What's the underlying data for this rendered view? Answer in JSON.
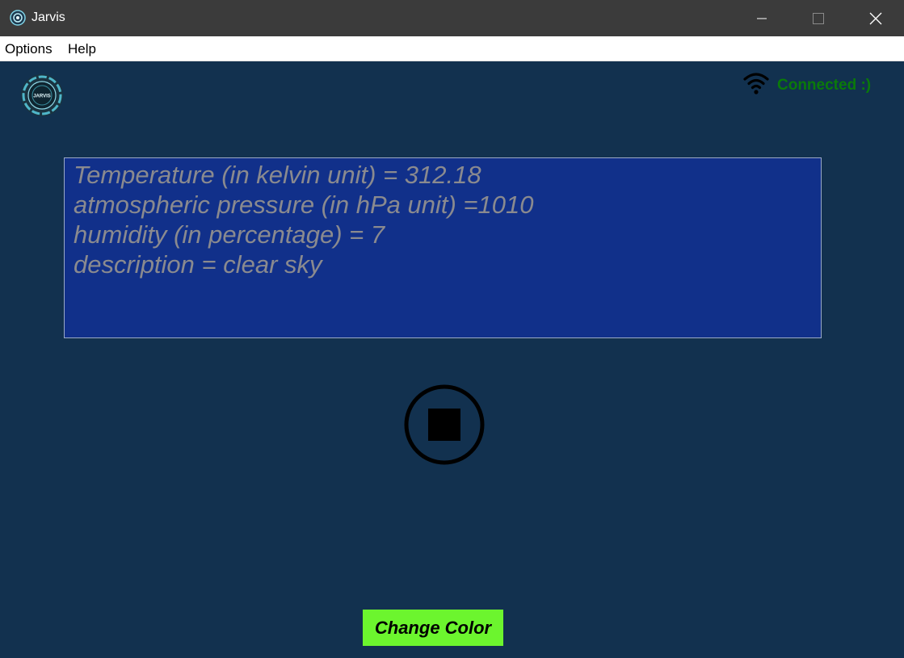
{
  "window": {
    "title": "Jarvis",
    "app_icon": "jarvis-globe-icon",
    "controls": [
      "minimize-icon",
      "maximize-icon",
      "close-icon"
    ]
  },
  "menu": {
    "options_label": "Options",
    "help_label": "Help"
  },
  "header": {
    "logo_icon": "jarvis-logo-icon",
    "logo_text": "JARVIS",
    "status_icon": "wifi-icon",
    "status_text": "Connected :)",
    "status_color": "#0a7a0a"
  },
  "output": {
    "lines": [
      "Temperature (in kelvin unit) = 312.18",
      "atmospheric pressure (in hPa unit) =1010",
      "humidity (in percentage) = 7",
      "description = clear sky"
    ]
  },
  "controls": {
    "stop_icon": "stop-circle-icon",
    "change_color_label": "Change Color"
  },
  "colors": {
    "background": "#12314f",
    "output_box": "#11308a",
    "output_text": "#8a8a8f",
    "change_color_button": "#6cf52e"
  }
}
